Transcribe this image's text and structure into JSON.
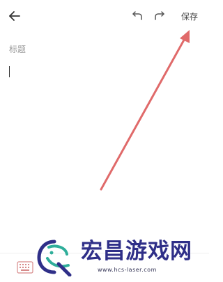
{
  "toolbar": {
    "back_icon": "arrow-left-icon",
    "undo_icon": "undo-icon",
    "redo_icon": "redo-icon",
    "save_label": "保存"
  },
  "editor": {
    "title_placeholder": "标题"
  },
  "bottom_bar": {
    "keyboard_icon": "keyboard-icon"
  },
  "watermark": {
    "title": "宏昌游戏网",
    "url": "www.hcs-laser.com"
  },
  "colors": {
    "arrow": "#e06a6a",
    "watermark_text": "#2f2f88",
    "watermark_logo_teal": "#2fae9a"
  }
}
